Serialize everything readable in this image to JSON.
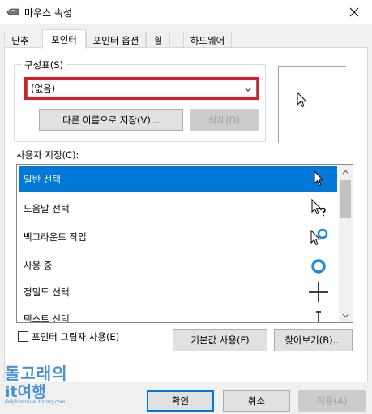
{
  "window": {
    "title": "마우스 속성",
    "close_glyph": "✕"
  },
  "tabs": [
    {
      "label": "단추"
    },
    {
      "label": "포인터"
    },
    {
      "label": "포인터 옵션"
    },
    {
      "label": "휠"
    },
    {
      "label": "하드웨어"
    }
  ],
  "active_tab": "포인터",
  "scheme": {
    "label": "구성표(S)",
    "selected": "(없음)",
    "save_as_label": "다른 이름으로 저장(V)...",
    "delete_label": "삭제(D)"
  },
  "customize": {
    "label": "사용자 지정(C):",
    "items": [
      {
        "label": "일반 선택",
        "icon": "arrow-cursor-icon",
        "selected": true
      },
      {
        "label": "도움말 선택",
        "icon": "help-cursor-icon",
        "selected": false
      },
      {
        "label": "백그라운드 작업",
        "icon": "working-in-background-cursor-icon",
        "selected": false
      },
      {
        "label": "사용 중",
        "icon": "busy-cursor-icon",
        "selected": false
      },
      {
        "label": "정밀도 선택",
        "icon": "precision-cursor-icon",
        "selected": false
      },
      {
        "label": "텍스트 선택",
        "icon": "text-cursor-icon",
        "selected": false
      }
    ]
  },
  "shadow_checkbox": {
    "label": "포인터 그림자 사용(E)",
    "checked": false
  },
  "buttons": {
    "use_default": "기본값 사용(F)",
    "browse": "찾아보기(B)...",
    "ok": "확인",
    "cancel": "취소",
    "apply": "적용(A)"
  },
  "watermark": {
    "line1": "돌고래의",
    "line2": "it여행",
    "line3": "dolphintravel.tistory.com"
  },
  "colors": {
    "accent": "#0078d7",
    "highlight_border": "#e21b23",
    "watermark": "#4a90d9"
  }
}
